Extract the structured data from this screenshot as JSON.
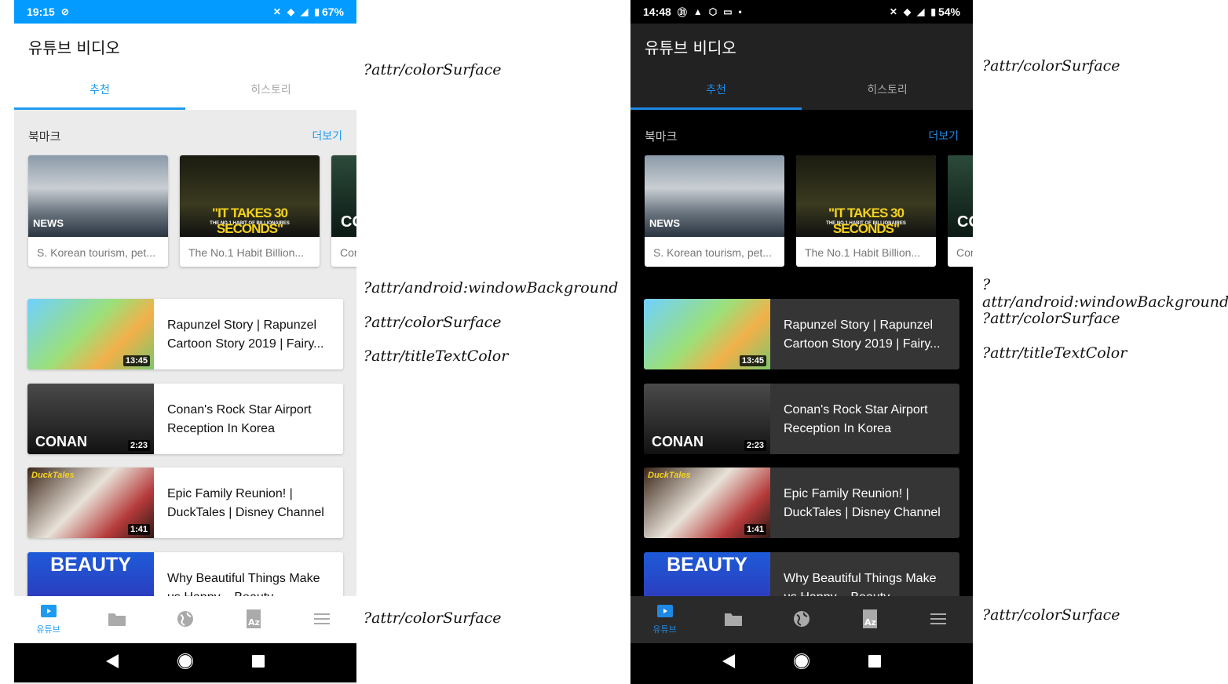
{
  "phones": [
    {
      "theme": "light",
      "status": {
        "time": "19:15",
        "battery": "67%",
        "icons": [
          "sync-icon",
          "bell-off-icon",
          "wifi-icon",
          "signal-icon",
          "battery-charging-icon"
        ]
      },
      "colors": {
        "status_bar": "#039BFF",
        "app_bar": "#FFFFFF",
        "title": "#111111",
        "tabs_bg": "#FFFFFF",
        "accent": "#1E9BF0",
        "tab_inactive": "#AAAAAA",
        "content_bg": "#EBEBEB",
        "section_text": "#333333",
        "card_bg": "#FFFFFF",
        "card_text": "#111111",
        "bottom_nav": "#FFFFFF",
        "nav_icon": "#AAAAAA"
      }
    },
    {
      "theme": "dark",
      "status": {
        "time": "14:48",
        "battery": "54%",
        "icons": [
          "calendar-31-icon",
          "warning-icon",
          "hexagon-play-icon",
          "cast-icon",
          "dot-icon",
          "bell-off-icon",
          "wifi-icon",
          "signal-icon",
          "battery-charging-icon"
        ]
      },
      "colors": {
        "status_bar": "#000000",
        "app_bar": "#222222",
        "title": "#FFFFFF",
        "tabs_bg": "#222222",
        "accent": "#1E88E5",
        "tab_inactive": "#AAAAAA",
        "content_bg": "#000000",
        "section_text": "#CCCCCC",
        "card_bg": "#353535",
        "card_text": "#FFFFFF",
        "bottom_nav": "#2A2A2A",
        "nav_icon": "#AAAAAA"
      }
    }
  ],
  "app": {
    "title": "유튜브 비디오",
    "tabs": [
      {
        "label": "추천",
        "active": true
      },
      {
        "label": "히스토리",
        "active": false
      }
    ]
  },
  "bookmarks": {
    "heading": "북마크",
    "more_label": "더보기",
    "items": [
      {
        "title": "S. Korean tourism, pet...",
        "thumb_text": "NEWS"
      },
      {
        "title": "The No.1 Habit Billion...",
        "thumb_text": "\"IT TAKES 30 SECONDS\"",
        "thumb_sub": "THE NO.1 HABIT OF BILLIONAIRES"
      },
      {
        "title": "Cor",
        "thumb_text": "CO"
      }
    ]
  },
  "videos": [
    {
      "title": "Rapunzel Story | Rapunzel Cartoon Story 2019 | Fairy...",
      "duration": "13:45"
    },
    {
      "title": "Conan's Rock Star Airport Reception In Korea",
      "duration": "2:23",
      "thumb_text": "CONAN"
    },
    {
      "title": "Epic Family Reunion! | DuckTales | Disney Channel",
      "duration": "1:41",
      "thumb_text": "DuckTales"
    },
    {
      "title": "Why Beautiful Things Make us Happy – Beauty",
      "thumb_text": "BEAUTY"
    }
  ],
  "bottom_nav": [
    {
      "icon": "youtube-play-icon",
      "label": "유튜브",
      "active": true
    },
    {
      "icon": "folder-icon"
    },
    {
      "icon": "globe-icon"
    },
    {
      "icon": "dictionary-az-icon"
    },
    {
      "icon": "menu-icon"
    }
  ],
  "annotations": [
    "?attr/colorSurface",
    "?attr/android:windowBackground",
    "?attr/colorSurface",
    "?attr/titleTextColor",
    "?attr/colorSurface"
  ]
}
